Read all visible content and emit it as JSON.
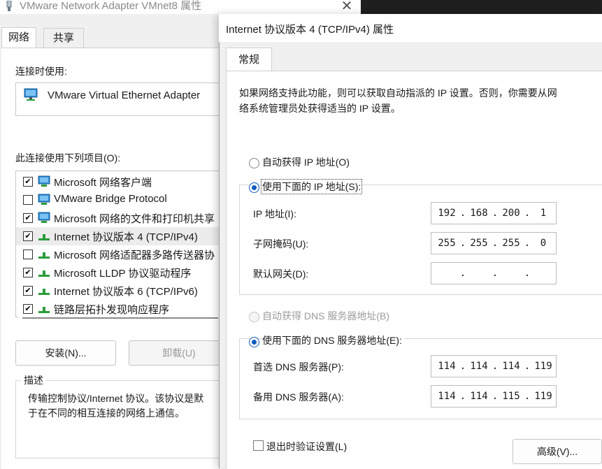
{
  "back_window": {
    "title": "VMware Network Adapter VMnet8 属性",
    "close_glyph": "✕",
    "tabs": [
      "网络",
      "共享"
    ],
    "connect_using_label": "连接时使用:",
    "adapter_name": "VMware Virtual Ethernet Adapter",
    "items_label": "此连接使用下列项目(O):",
    "items": [
      {
        "label": "Microsoft 网络客户端",
        "checked": true,
        "icon": "network-client-icon"
      },
      {
        "label": "VMware Bridge Protocol",
        "checked": false,
        "icon": "network-client-icon"
      },
      {
        "label": "Microsoft 网络的文件和打印机共享",
        "checked": true,
        "icon": "network-client-icon"
      },
      {
        "label": "Internet 协议版本 4 (TCP/IPv4)",
        "checked": true,
        "icon": "protocol-icon",
        "selected": true
      },
      {
        "label": "Microsoft 网络适配器多路传送器协",
        "checked": false,
        "icon": "protocol-icon"
      },
      {
        "label": "Microsoft LLDP 协议驱动程序",
        "checked": true,
        "icon": "protocol-icon"
      },
      {
        "label": "Internet 协议版本 6 (TCP/IPv6)",
        "checked": true,
        "icon": "protocol-icon"
      },
      {
        "label": "链路层拓扑发现响应程序",
        "checked": true,
        "icon": "protocol-icon"
      }
    ],
    "install_button": "安装(N)...",
    "uninstall_button": "卸载(U)",
    "description_legend": "描述",
    "description_text": "传输控制协议/Internet 协议。该协议是默\n于在不同的相互连接的网络上通信。"
  },
  "dialog": {
    "title": "Internet 协议版本 4 (TCP/IPv4) 属性",
    "tab": "常规",
    "intro": "如果网络支持此功能，则可以获取自动指派的 IP 设置。否则，你需要从网\n络系统管理员处获得适当的 IP 设置。",
    "radio_auto_ip": "自动获得 IP 地址(O)",
    "radio_manual_ip": "使用下面的 IP 地址(S):",
    "ip_label": "IP 地址(I):",
    "subnet_label": "子网掩码(U):",
    "gateway_label": "默认网关(D):",
    "ip_octets": [
      "192",
      "168",
      "200",
      "1"
    ],
    "subnet_octets": [
      "255",
      "255",
      "255",
      "0"
    ],
    "gateway_octets": [
      "",
      "",
      "",
      ""
    ],
    "radio_auto_dns": "自动获得 DNS 服务器地址(B)",
    "radio_manual_dns": "使用下面的 DNS 服务器地址(E):",
    "preferred_dns_label": "首选 DNS 服务器(P):",
    "alternate_dns_label": "备用 DNS 服务器(A):",
    "preferred_dns_octets": [
      "114",
      "114",
      "114",
      "119"
    ],
    "alternate_dns_octets": [
      "114",
      "114",
      "115",
      "119"
    ],
    "validate_on_exit": "退出时验证设置(L)",
    "advanced_button": "高级(V)..."
  },
  "colors": {
    "radio_accent": "#0f5cc0",
    "window_bg": "#f0f0f0",
    "panel_bg": "#ffffff"
  }
}
